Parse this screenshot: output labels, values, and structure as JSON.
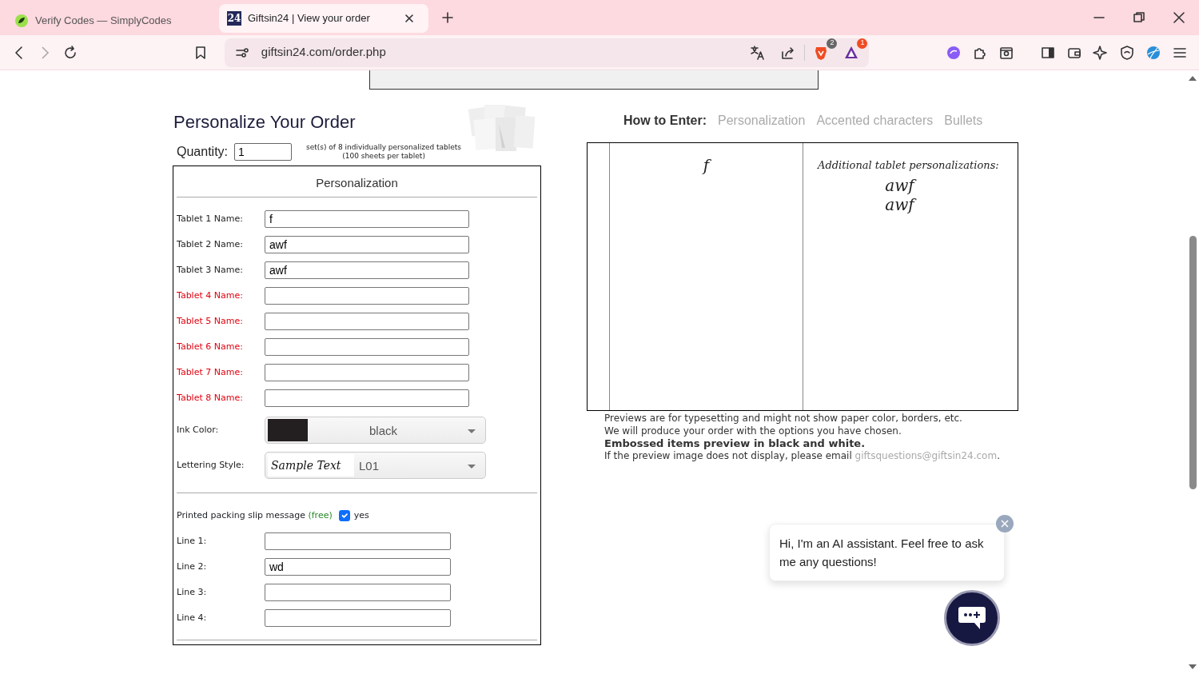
{
  "browser": {
    "tabs": [
      {
        "title": "Verify Codes — SimplyCodes",
        "selected": false
      },
      {
        "title": "Giftsin24 | View your order",
        "selected": true,
        "favicon_text": "24"
      }
    ],
    "url": "giftsin24.com/order.php",
    "shield_count": "2",
    "rewards_count": "1"
  },
  "page": {
    "heading": "Personalize Your Order",
    "quantity": {
      "label": "Quantity:",
      "value": "1",
      "note": [
        "set(s) of 8 individually personalized tablets",
        "(100 sheets per tablet)"
      ]
    },
    "personalization": {
      "title": "Personalization",
      "tablets": [
        {
          "label": "Tablet 1 Name:",
          "value": "f",
          "missing": false
        },
        {
          "label": "Tablet 2 Name:",
          "value": "awf",
          "missing": false
        },
        {
          "label": "Tablet 3 Name:",
          "value": "awf",
          "missing": false
        },
        {
          "label": "Tablet 4 Name:",
          "missing": true
        },
        {
          "label": "Tablet 5 Name:",
          "missing": true
        },
        {
          "label": "Tablet 6 Name:",
          "missing": true
        },
        {
          "label": "Tablet 7 Name:",
          "missing": true
        },
        {
          "label": "Tablet 8 Name:",
          "missing": true
        }
      ],
      "ink_color": {
        "label": "Ink Color:",
        "value": "black",
        "color": "#231f20"
      },
      "lettering": {
        "label": "Lettering Style:",
        "sample": "Sample Text",
        "value": "L01"
      },
      "packing_slip": {
        "label": "Printed packing slip message",
        "free": "(free)",
        "checked": true,
        "option": "yes"
      },
      "lines": [
        {
          "label": "Line 1:"
        },
        {
          "label": "Line 2:",
          "value": "wd"
        },
        {
          "label": "Line 3:"
        },
        {
          "label": "Line 4:"
        }
      ]
    },
    "how_to_enter": {
      "label": "How to Enter:",
      "links": [
        "Personalization",
        "Accented characters",
        "Bullets"
      ]
    },
    "preview": {
      "first_name": "f",
      "additional_title": "Additional tablet personalizations:",
      "additional_names": [
        "awf",
        "awf"
      ]
    },
    "notes": [
      "Previews are for typesetting and might not show paper color, borders, etc.",
      "We will produce your order with the options you have chosen."
    ],
    "bold_note": "Embossed items preview in black and white.",
    "email_note": {
      "text": "If the preview image does not display, please email",
      "email": "giftsquestions@giftsin24.com",
      "end": "."
    },
    "chat": {
      "message": "Hi, I'm an AI assistant. Feel free to ask me any questions!"
    }
  }
}
